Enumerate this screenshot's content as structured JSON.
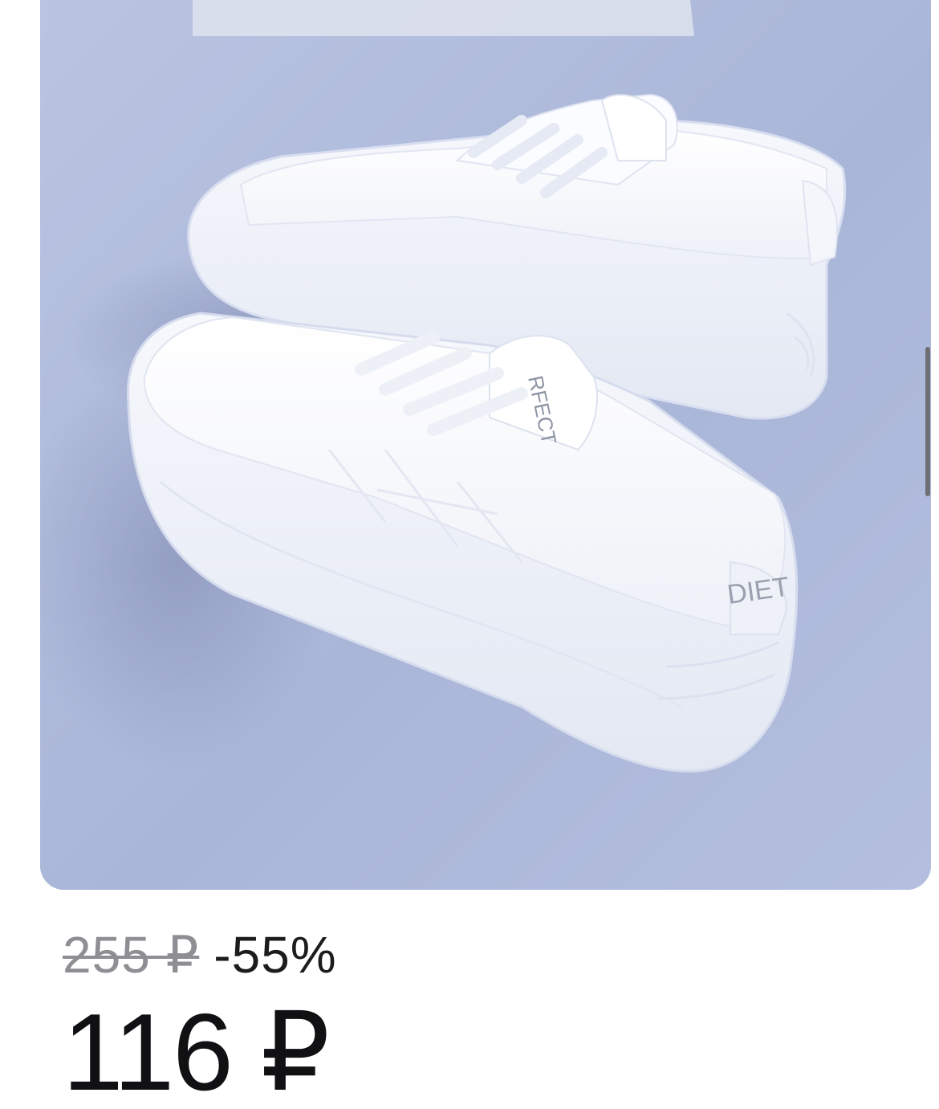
{
  "product": {
    "image_alt": "product-photo-white-platform-sneakers",
    "shoe_print_front": "DIET",
    "shoe_print_tongue": "RFECT"
  },
  "pricing": {
    "old_price": "255 ₽",
    "discount": "-55%",
    "current_price": "116 ₽"
  },
  "colors": {
    "photo_bg": "#aebadb",
    "old_price": "#8e8e93",
    "price_text": "#111114"
  }
}
